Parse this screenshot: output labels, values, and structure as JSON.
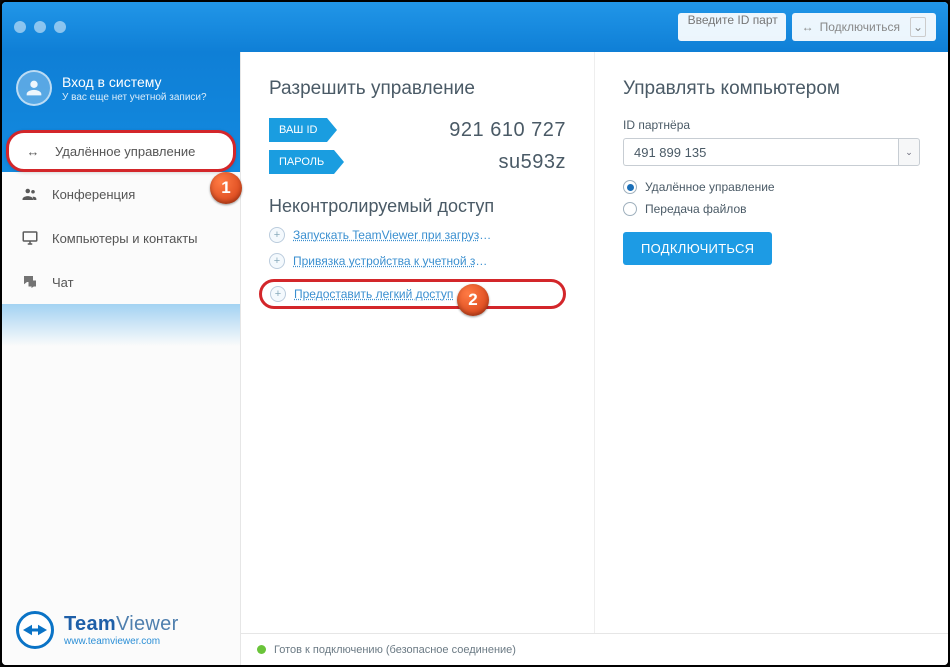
{
  "top": {
    "partner_id_placeholder": "Введите ID парт",
    "connect_label": "Подключиться"
  },
  "login": {
    "title": "Вход в систему",
    "subtitle": "У вас еще нет учетной записи?"
  },
  "nav": {
    "remote": "Удалённое управление",
    "meeting": "Конференция",
    "contacts": "Компьютеры и контакты",
    "chat": "Чат"
  },
  "badges": {
    "one": "1",
    "two": "2"
  },
  "logo": {
    "team": "Team",
    "viewer": "Viewer",
    "url": "www.teamviewer.com"
  },
  "allow": {
    "heading": "Разрешить управление",
    "your_id_label": "ВАШ ID",
    "your_id_value": "921 610 727",
    "password_label": "ПАРОЛЬ",
    "password_value": "su593z"
  },
  "unattended": {
    "heading": "Неконтролируемый доступ",
    "item1": "Запускать TeamViewer при загрузке с...",
    "item2": "Привязка устройства к учетной записи",
    "item3": "Предоставить легкий доступ"
  },
  "control": {
    "heading": "Управлять компьютером",
    "partner_label": "ID партнёра",
    "partner_value": "491 899 135",
    "radio_remote": "Удалённое управление",
    "radio_files": "Передача файлов",
    "connect_btn": "ПОДКЛЮЧИТЬСЯ"
  },
  "status": {
    "text": "Готов к подключению (безопасное соединение)"
  }
}
